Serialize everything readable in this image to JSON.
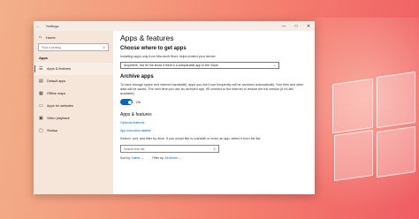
{
  "window": {
    "title": "Settings",
    "back_glyph": "←",
    "minimize_glyph": "—",
    "maximize_glyph": "□",
    "close_glyph": "✕"
  },
  "sidebar": {
    "home_label": "Home",
    "search_placeholder": "Find a setting",
    "section": "Apps",
    "items": [
      {
        "label": "Apps & features",
        "icon": "apps-list-icon",
        "glyph": "☰",
        "selected": true
      },
      {
        "label": "Default apps",
        "icon": "default-apps-icon",
        "glyph": "▤",
        "selected": false
      },
      {
        "label": "Offline maps",
        "icon": "map-icon",
        "glyph": "▦",
        "selected": false
      },
      {
        "label": "Apps for websites",
        "icon": "web-apps-icon",
        "glyph": "▭",
        "selected": false
      },
      {
        "label": "Video playback",
        "icon": "video-icon",
        "glyph": "▣",
        "selected": false
      },
      {
        "label": "Startup",
        "icon": "startup-icon",
        "glyph": "▢",
        "selected": false
      }
    ]
  },
  "main": {
    "page_title": "Apps & features",
    "get_apps": {
      "heading": "Choose where to get apps",
      "description": "Installing apps only from Microsoft Store helps protect your device.",
      "dropdown_value": "Anywhere, but let me know if there's a comparable app in the Store"
    },
    "archive": {
      "heading": "Archive apps",
      "description": "To save storage space and internet bandwidth, apps you don't use frequently will be archived automatically. Your files and other data will be saved. The next time you use an archived app, it'll connect to the internet to restore the full version (if it's still available).",
      "toggle_label": "On",
      "toggle_on": true
    },
    "apps_features": {
      "heading": "Apps & features",
      "link1": "Optional features",
      "link2": "App execution aliases",
      "description": "Search, sort, and filter by drive. If you would like to uninstall or move an app, select it from the list.",
      "search_placeholder": "Search this list",
      "sort_label": "Sort by:",
      "sort_value": "Name",
      "filter_label": "Filter by:",
      "filter_value": "All drives"
    }
  },
  "colors": {
    "accent": "#0067c0",
    "sidebar_bg": "#f6e5d9"
  }
}
